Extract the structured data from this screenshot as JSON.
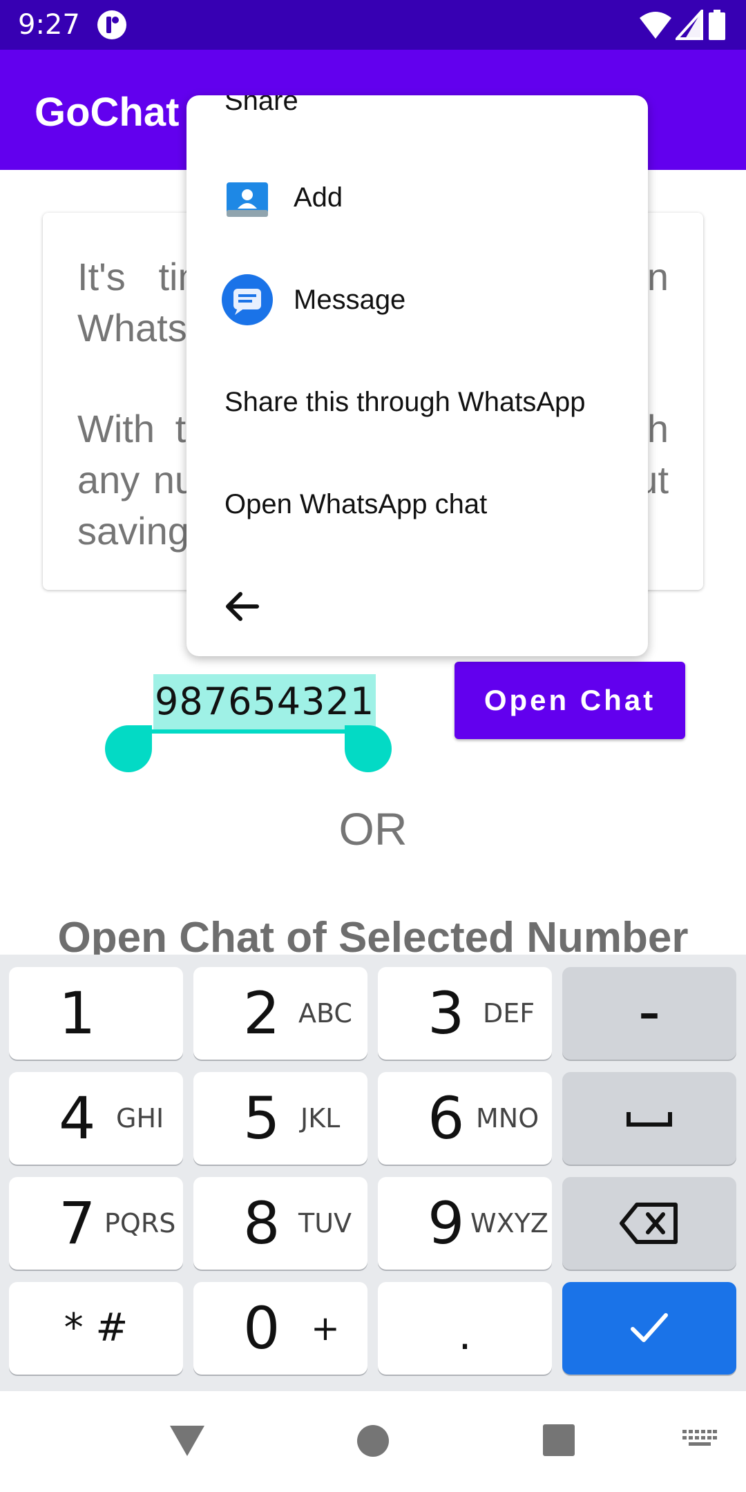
{
  "status_bar": {
    "time": "9:27"
  },
  "app_bar": {
    "title": "GoChat"
  },
  "card": {
    "paragraph1": "It's time to make chatting on WhatsApp the easiest.",
    "paragraph2": "With this app you can chat with any number on WhatsApp without saving it."
  },
  "number_input": {
    "value": "987654321"
  },
  "open_chat_button": {
    "label": "Open Chat"
  },
  "or_label": "OR",
  "selected_number_heading": "Open Chat of Selected Number",
  "popup_menu": {
    "share_label": "Share",
    "items": [
      {
        "label": "Add",
        "icon": "contacts-add-icon"
      },
      {
        "label": "Message",
        "icon": "messages-icon"
      },
      {
        "label": "Share this through WhatsApp"
      },
      {
        "label": "Open WhatsApp chat"
      }
    ],
    "back_icon": "arrow-back-icon"
  },
  "keyboard": {
    "keys": [
      {
        "digit": "1",
        "letters": ""
      },
      {
        "digit": "2",
        "letters": "ABC"
      },
      {
        "digit": "3",
        "letters": "DEF"
      },
      {
        "symbol": "–"
      },
      {
        "digit": "4",
        "letters": "GHI"
      },
      {
        "digit": "5",
        "letters": "JKL"
      },
      {
        "digit": "6",
        "letters": "MNO"
      },
      {
        "icon": "space-icon"
      },
      {
        "digit": "7",
        "letters": "PQRS"
      },
      {
        "digit": "8",
        "letters": "TUV"
      },
      {
        "digit": "9",
        "letters": "WXYZ"
      },
      {
        "icon": "backspace-icon"
      },
      {
        "symbol": "* #"
      },
      {
        "digit": "0",
        "letters": "+"
      },
      {
        "symbol": "."
      },
      {
        "icon": "check-icon"
      }
    ]
  },
  "colors": {
    "status_bar": "#3700b3",
    "primary": "#6200ee",
    "accent": "#03dac5",
    "enter_key": "#1a73e8"
  }
}
